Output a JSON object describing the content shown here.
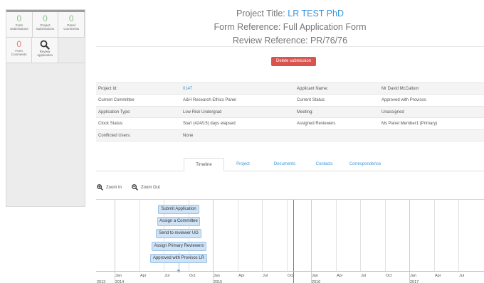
{
  "sidebar": {
    "tiles": [
      {
        "count": "0",
        "label_line1": "Form",
        "label_line2": "Submissions"
      },
      {
        "count": "0",
        "label_line1": "Project",
        "label_line2": "Submissions"
      },
      {
        "count": "0",
        "label_line1": "Panel",
        "label_line2": "Comments"
      },
      {
        "count": "0",
        "label_line1": "Form",
        "label_line2": "Comments"
      }
    ],
    "review_tile": {
      "label_line1": "Review",
      "label_line2": "Application",
      "icon": "magnifier-icon"
    }
  },
  "header": {
    "project_title_prefix": "Project Title: ",
    "project_title_link": "LR TEST PhD",
    "form_reference": "Form Reference: Full Application Form",
    "review_reference": "Review Reference: PR/76/76"
  },
  "actions": {
    "delete_label": "Delete submission"
  },
  "details": [
    {
      "l1": "Project Id:",
      "v1": "0147",
      "l2": "Applicant Name:",
      "v2": "Mr David McCallum"
    },
    {
      "l1": "Current Committee",
      "v1": "A&H Research Ethics Panel",
      "l2": "Current Status:",
      "v2": "Approved with Provisos"
    },
    {
      "l1": "Application Type:",
      "v1": "Low Risk Undergrad",
      "l2": "Meeting:",
      "v2": "Unassigned"
    },
    {
      "l1": "Clock Status:",
      "v1": "Start (424/15) days elapsed",
      "l2": "Assigned Reviewers",
      "v2": "Ms Panel Member1 (Primary)"
    },
    {
      "l1": "Conflicted Users:",
      "v1": "None",
      "l2": "",
      "v2": ""
    }
  ],
  "tabs": [
    "Timeline",
    "Project",
    "Documents",
    "Contacts",
    "Correspondence"
  ],
  "active_tab": "Timeline",
  "zoom": {
    "in_label": "Zoom In",
    "out_label": "Zoom Out"
  },
  "timeline": {
    "events": [
      "Submit Application",
      "Assign a Committee",
      "Send to reviewer UG",
      "Assign Primary Reviewers",
      "Approved with Provisos LR"
    ],
    "axis_months": [
      "Jan",
      "Apr",
      "Jul",
      "Oct",
      "Jan",
      "Apr",
      "Jul",
      "Oct",
      "Jan",
      "Apr",
      "Jul",
      "Oct",
      "Jan",
      "Apr",
      "Jul"
    ],
    "year_labels": [
      "2013",
      "2014",
      "2015",
      "2016",
      "2017"
    ]
  },
  "colors": {
    "accent": "#3a95d8",
    "danger": "#d9534f",
    "count_green": "#8bc48b",
    "count_red": "#e07b7b",
    "today_line": "#d25a45"
  }
}
